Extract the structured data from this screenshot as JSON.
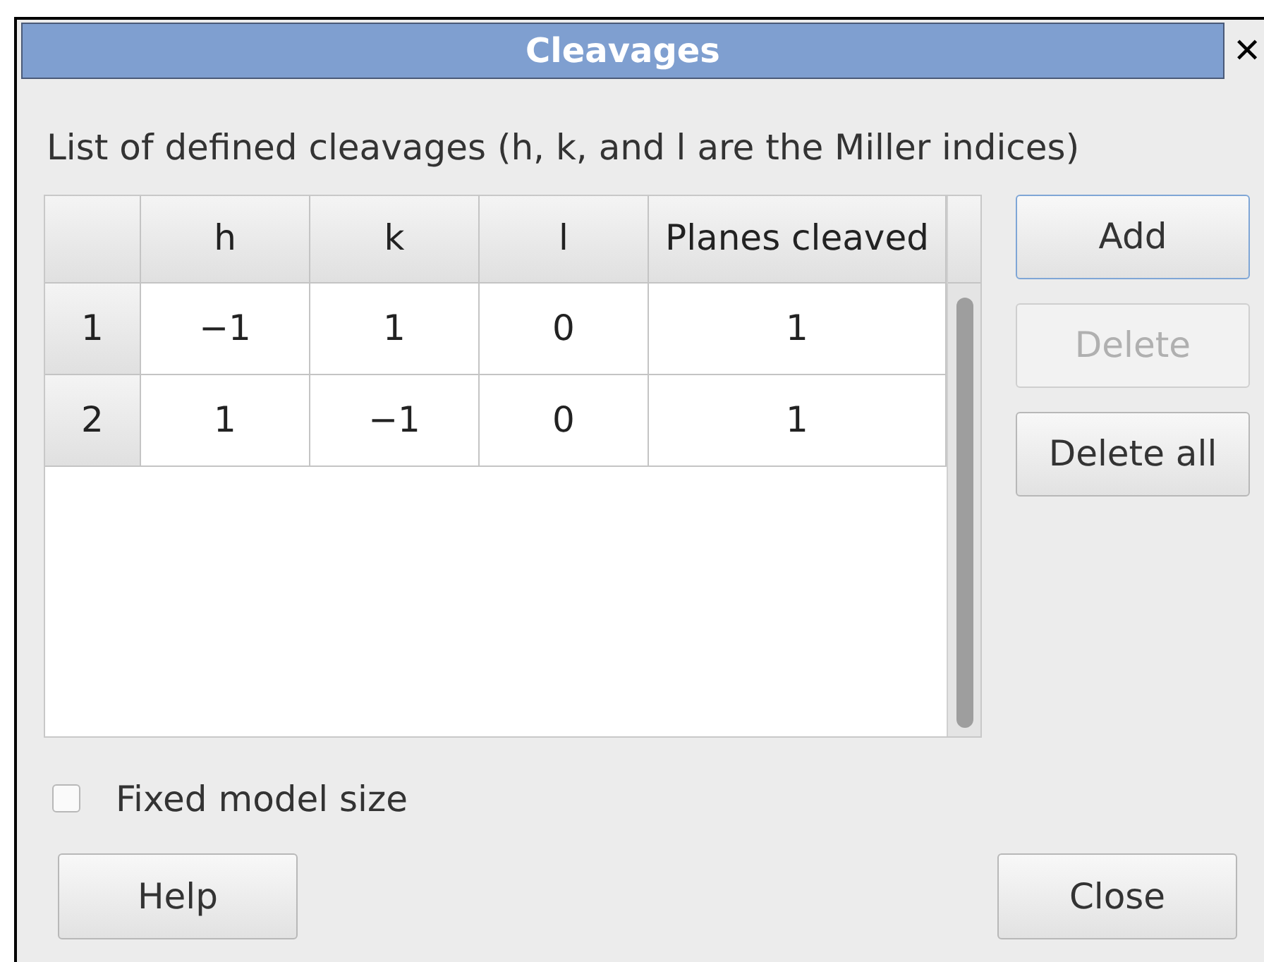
{
  "window": {
    "title": "Cleavages",
    "close": "✕"
  },
  "description": "List of defined cleavages (h, k, and l are the Miller indices)",
  "table": {
    "columns": [
      "h",
      "k",
      "l",
      "Planes cleaved"
    ],
    "rows": [
      {
        "header": "1",
        "cells": [
          "−1",
          "1",
          "0",
          "1"
        ]
      },
      {
        "header": "2",
        "cells": [
          "1",
          "−1",
          "0",
          "1"
        ]
      }
    ]
  },
  "side_buttons": [
    {
      "label": "Add",
      "disabled": false,
      "focused": true
    },
    {
      "label": "Delete",
      "disabled": true,
      "focused": false
    },
    {
      "label": "Delete all",
      "disabled": false,
      "focused": false
    }
  ],
  "fixed_model_size": {
    "label": "Fixed model size",
    "checked": false
  },
  "buttons": [
    "Help",
    "Close"
  ]
}
